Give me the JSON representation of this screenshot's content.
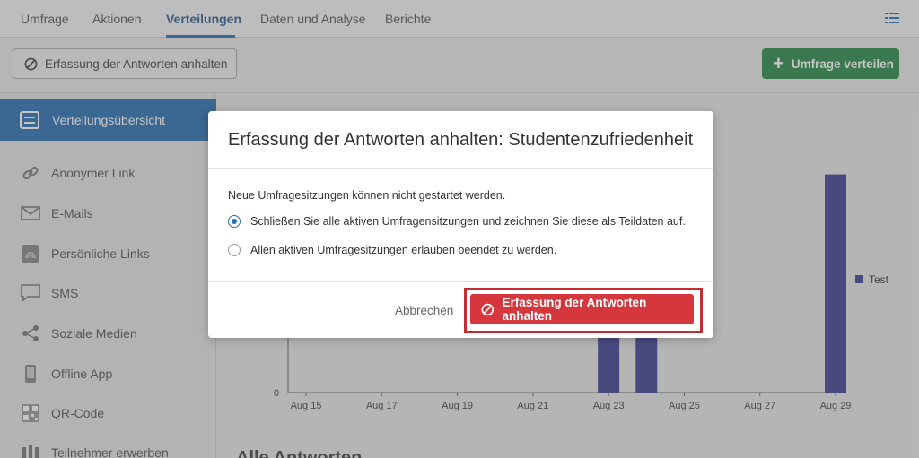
{
  "nav": {
    "tabs": [
      {
        "label": "Umfrage"
      },
      {
        "label": "Aktionen"
      },
      {
        "label": "Verteilungen"
      },
      {
        "label": "Daten und Analyse"
      },
      {
        "label": "Berichte"
      }
    ],
    "active_tab": "Verteilungen",
    "right_icon": "list-icon"
  },
  "toolbar": {
    "stop_label": "Erfassung der Antworten anhalten",
    "distribute_label": "Umfrage verteilen"
  },
  "sidebar": {
    "active": {
      "label": "Verteilungsübersicht",
      "icon": "list-box-icon"
    },
    "items": [
      {
        "label": "Anonymer Link",
        "icon": "link-icon"
      },
      {
        "label": "E-Mails",
        "icon": "envelope-icon"
      },
      {
        "label": "Persönliche Links",
        "icon": "fingerprint-icon"
      },
      {
        "label": "SMS",
        "icon": "chat-bubble-icon"
      },
      {
        "label": "Soziale Medien",
        "icon": "share-icon"
      },
      {
        "label": "Offline App",
        "icon": "mobile-icon"
      },
      {
        "label": "QR-Code",
        "icon": "qr-code-icon"
      },
      {
        "label": "Teilnehmer erwerben",
        "icon": "people-icon"
      }
    ]
  },
  "chart_data": {
    "type": "bar",
    "categories": [
      "Aug 15",
      "Aug 17",
      "Aug 19",
      "Aug 21",
      "Aug 23",
      "Aug 25",
      "Aug 27",
      "Aug 29"
    ],
    "x_ticks": [
      "Aug 15",
      "Aug 17",
      "Aug 19",
      "Aug 21",
      "Aug 23",
      "Aug 25",
      "Aug 27",
      "Aug 29"
    ],
    "y_ticks": [
      "0"
    ],
    "series": [
      {
        "name": "Test",
        "color": "#3f4294",
        "points": [
          {
            "x": "Aug 23",
            "value": 3
          },
          {
            "x": "Aug 24",
            "value": 2
          },
          {
            "x": "Aug 29",
            "value": 6
          }
        ]
      }
    ],
    "legend": "right",
    "ylim": [
      0,
      7
    ]
  },
  "bottom_heading": "Alle Antworten",
  "modal": {
    "title": "Erfassung der Antworten anhalten: Studentenzufriedenheit",
    "info": "Neue Umfragesitzungen können nicht gestartet werden.",
    "options": [
      {
        "label": "Schließen Sie alle aktiven Umfragensitzungen und zeichnen Sie diese als Teildaten auf.",
        "checked": true
      },
      {
        "label": "Allen aktiven Umfragesitzungen erlauben beendet zu werden.",
        "checked": false
      }
    ],
    "cancel_label": "Abbrechen",
    "confirm_label": "Erfassung der Antworten anhalten"
  },
  "colors": {
    "accent_blue": "#2c6fb3",
    "green": "#2a8b4a",
    "danger_red": "#d6373d",
    "bar": "#3f4294"
  }
}
